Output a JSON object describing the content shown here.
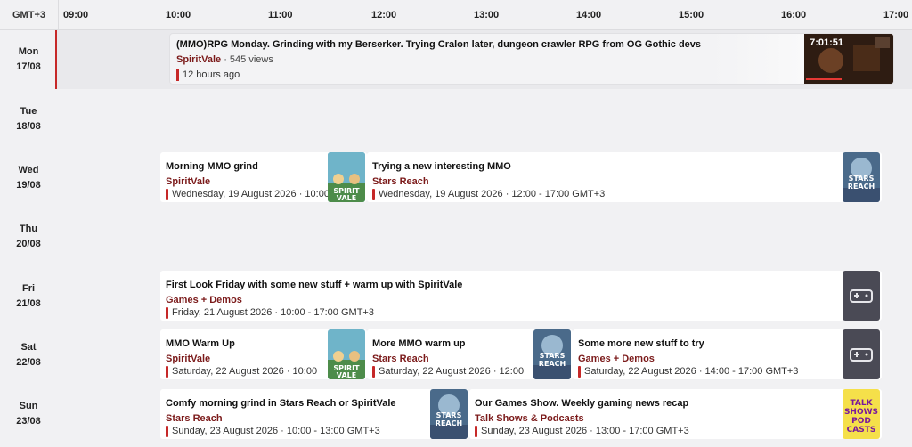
{
  "timezone": "GMT+3",
  "hours": [
    "09:00",
    "10:00",
    "11:00",
    "12:00",
    "13:00",
    "14:00",
    "15:00",
    "16:00",
    "17:00"
  ],
  "days": [
    {
      "name": "Mon",
      "date": "17/08"
    },
    {
      "name": "Tue",
      "date": "18/08"
    },
    {
      "name": "Wed",
      "date": "19/08"
    },
    {
      "name": "Thu",
      "date": "20/08"
    },
    {
      "name": "Fri",
      "date": "21/08"
    },
    {
      "name": "Sat",
      "date": "22/08"
    },
    {
      "name": "Sun",
      "date": "23/08"
    }
  ],
  "vod": {
    "title": "(MMO)RPG Monday. Grinding with my Berserker. Trying Cralon later, dungeon crawler RPG from OG Gothic devs",
    "channel": "SpiritVale",
    "views": " · 545 views",
    "ago": "12 hours ago",
    "duration": "7:01:51"
  },
  "events": {
    "wed1": {
      "title": "Morning MMO grind",
      "category": "SpiritVale",
      "meta": "Wednesday, 19 August 2026 · 10:00",
      "thumb": "SPIRIT VALE"
    },
    "wed2": {
      "title": "Trying a new interesting MMO",
      "category": "Stars Reach",
      "meta": "Wednesday, 19 August 2026 · 12:00 - 17:00 GMT+3",
      "thumb": "STARS REACH"
    },
    "fri1": {
      "title": "First Look Friday with some new stuff + warm up with SpiritVale",
      "category": "Games + Demos",
      "meta": "Friday, 21 August 2026 · 10:00 - 17:00 GMT+3"
    },
    "sat1": {
      "title": "MMO Warm Up",
      "category": "SpiritVale",
      "meta": "Saturday, 22 August 2026 · 10:00",
      "thumb": "SPIRIT VALE"
    },
    "sat2": {
      "title": "More MMO warm up",
      "category": "Stars Reach",
      "meta": "Saturday, 22 August 2026 · 12:00",
      "thumb": "STARS REACH"
    },
    "sat3": {
      "title": "Some more new stuff to try",
      "category": "Games + Demos",
      "meta": "Saturday, 22 August 2026 · 14:00 - 17:00 GMT+3"
    },
    "sun1": {
      "title": "Comfy morning grind in Stars Reach or SpiritVale",
      "category": "Stars Reach",
      "meta": "Sunday, 23 August 2026 · 10:00 - 13:00 GMT+3",
      "thumb": "STARS REACH"
    },
    "sun2": {
      "title": "Our Games Show. Weekly gaming news recap",
      "category": "Talk Shows & Podcasts",
      "meta": "Sunday, 23 August 2026 · 13:00 - 17:00 GMT+3",
      "thumb": "TALK SHOWS PODCASTS"
    }
  },
  "icons": {
    "gamepad": "gamepad-icon"
  },
  "colors": {
    "accent": "#c62828",
    "category": "#7b1a1a",
    "gamepad_bg": "#4a4a55"
  }
}
